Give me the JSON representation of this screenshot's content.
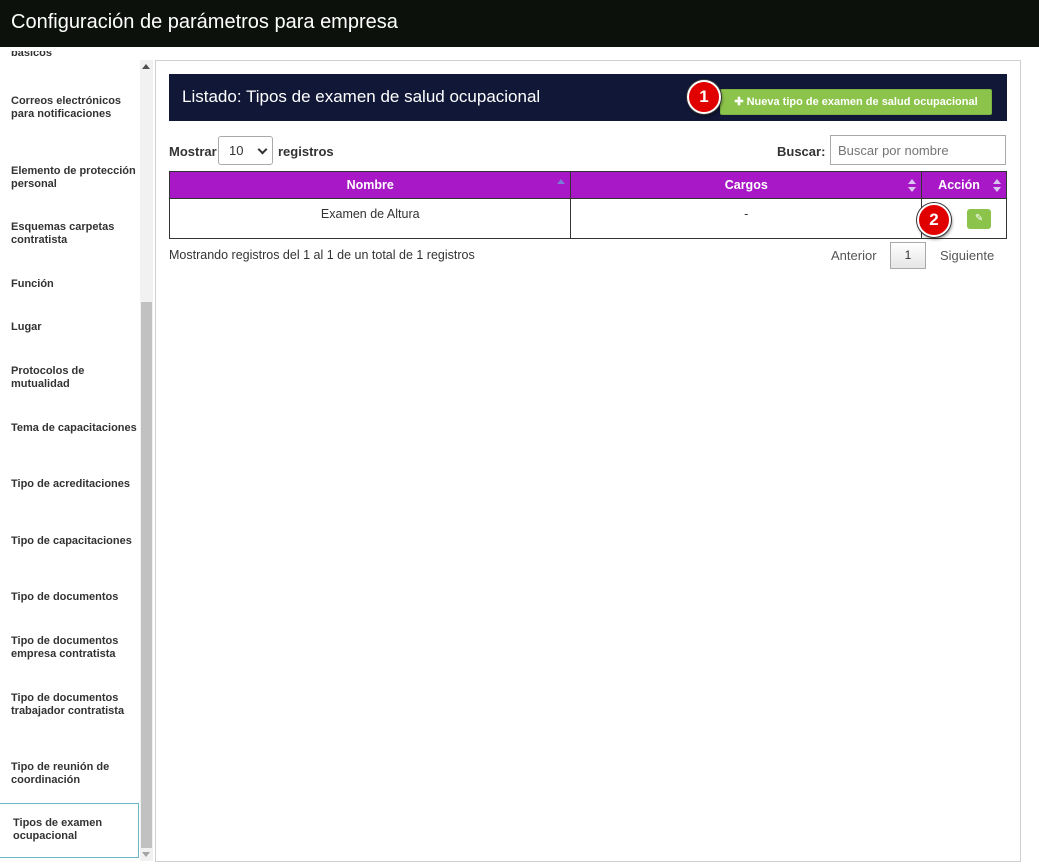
{
  "app": {
    "title": "Configuración de parámetros para empresa"
  },
  "sidebar": {
    "items": [
      {
        "label": "básicos"
      },
      {
        "label": "Correos electrónicos para notificaciones"
      },
      {
        "label": "Elemento de protección personal"
      },
      {
        "label": "Esquemas carpetas contratista"
      },
      {
        "label": "Función"
      },
      {
        "label": "Lugar"
      },
      {
        "label": "Protocolos de mutualidad"
      },
      {
        "label": "Tema de capacitaciones"
      },
      {
        "label": "Tipo de acreditaciones"
      },
      {
        "label": "Tipo de capacitaciones"
      },
      {
        "label": "Tipo de documentos"
      },
      {
        "label": "Tipo de documentos empresa contratista"
      },
      {
        "label": "Tipo de documentos trabajador contratista"
      },
      {
        "label": "Tipo de reunión de coordinación"
      },
      {
        "label": "Tipos de examen ocupacional"
      }
    ],
    "active_index": 14
  },
  "listing": {
    "title": "Listado: Tipos de examen de salud ocupacional",
    "new_button": {
      "icon": "plus-icon",
      "label": "Nueva tipo de examen de salud ocupacional"
    }
  },
  "controls": {
    "show_label": "Mostrar",
    "length_value": "10",
    "records_label": "registros",
    "search_label": "Buscar:",
    "search_placeholder": "Buscar por nombre"
  },
  "table": {
    "headers": [
      "Nombre",
      "Cargos",
      "Acción"
    ],
    "rows": [
      {
        "nombre": "Examen de Altura",
        "cargos": "-",
        "action_icon": "pencil-icon"
      }
    ]
  },
  "footer": {
    "info": "Mostrando registros del 1 al 1 de un total de 1 registros",
    "prev": "Anterior",
    "page": "1",
    "next": "Siguiente"
  },
  "annotations": {
    "badge1": "1",
    "badge2": "2"
  },
  "colors": {
    "titlebar": "#0c110c",
    "header_bg": "#101737",
    "table_header": "#a818c6",
    "button_green": "#8cc34a",
    "badge_red": "#e00000"
  }
}
